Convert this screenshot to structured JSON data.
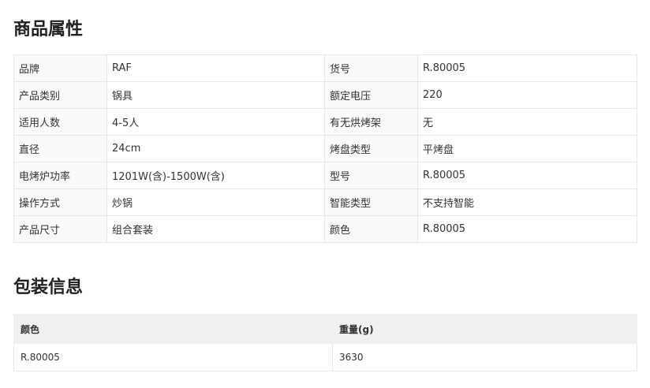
{
  "attributes": {
    "title": "商品属性",
    "rows": [
      {
        "k1": "品牌",
        "v1": "RAF",
        "k2": "货号",
        "v2": "R.80005"
      },
      {
        "k1": "产品类别",
        "v1": "锅具",
        "k2": "额定电压",
        "v2": "220"
      },
      {
        "k1": "适用人数",
        "v1": "4-5人",
        "k2": "有无烘烤架",
        "v2": "无"
      },
      {
        "k1": "直径",
        "v1": "24cm",
        "k2": "烤盘类型",
        "v2": "平烤盘"
      },
      {
        "k1": "电烤炉功率",
        "v1": "1201W(含)-1500W(含)",
        "k2": "型号",
        "v2": "R.80005"
      },
      {
        "k1": "操作方式",
        "v1": "炒锅",
        "k2": "智能类型",
        "v2": "不支持智能"
      },
      {
        "k1": "产品尺寸",
        "v1": "组合套装",
        "k2": "颜色",
        "v2": "R.80005"
      }
    ]
  },
  "packaging": {
    "title": "包装信息",
    "headers": [
      "颜色",
      "重量(g)"
    ],
    "rows": [
      [
        "R.80005",
        "3630"
      ]
    ]
  }
}
